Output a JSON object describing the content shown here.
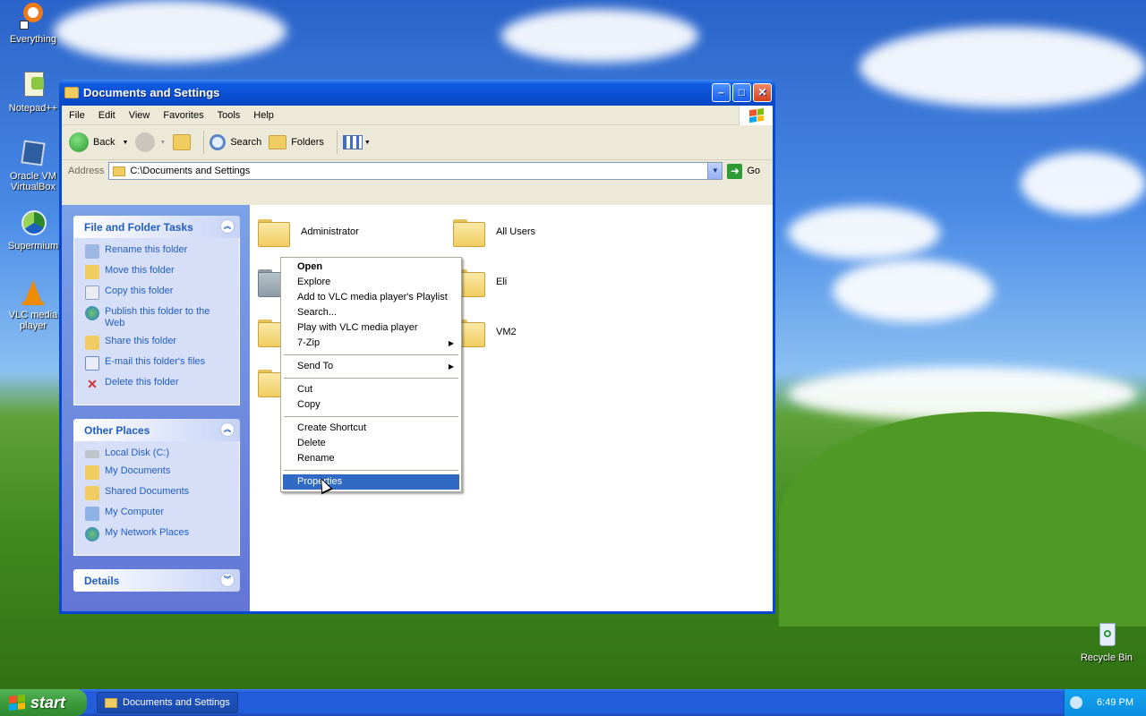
{
  "desktop": {
    "icons": [
      {
        "label": "Everything"
      },
      {
        "label": "Notepad++"
      },
      {
        "label": "Oracle VM VirtualBox"
      },
      {
        "label": "Supermium"
      },
      {
        "label": "VLC media player"
      },
      {
        "label": "Recycle Bin"
      }
    ]
  },
  "window": {
    "title": "Documents and Settings",
    "menu": [
      "File",
      "Edit",
      "View",
      "Favorites",
      "Tools",
      "Help"
    ],
    "toolbar": {
      "back": "Back",
      "search": "Search",
      "folders": "Folders"
    },
    "address": {
      "label": "Address",
      "value": "C:\\Documents and Settings",
      "go": "Go"
    }
  },
  "taskpane": {
    "file_tasks": {
      "title": "File and Folder Tasks",
      "items": [
        "Rename this folder",
        "Move this folder",
        "Copy this folder",
        "Publish this folder to the Web",
        "Share this folder",
        "E-mail this folder's files",
        "Delete this folder"
      ]
    },
    "other_places": {
      "title": "Other Places",
      "items": [
        "Local Disk (C:)",
        "My Documents",
        "Shared Documents",
        "My Computer",
        "My Network Places"
      ]
    },
    "details": {
      "title": "Details"
    }
  },
  "folders": [
    {
      "name": "Administrator"
    },
    {
      "name": "All Users"
    },
    {
      "name": "Eli"
    },
    {
      "name": "VM2"
    }
  ],
  "context_menu": {
    "items": [
      {
        "label": "Open"
      },
      {
        "label": "Explore"
      },
      {
        "label": "Add to VLC media player's Playlist"
      },
      {
        "label": "Search..."
      },
      {
        "label": "Play with VLC media player"
      },
      {
        "label": "7-Zip"
      },
      {
        "label": "Send To"
      },
      {
        "label": "Cut"
      },
      {
        "label": "Copy"
      },
      {
        "label": "Create Shortcut"
      },
      {
        "label": "Delete"
      },
      {
        "label": "Rename"
      },
      {
        "label": "Properties"
      }
    ]
  },
  "taskbar": {
    "start": "start",
    "task": "Documents and Settings",
    "clock": "6:49 PM"
  }
}
